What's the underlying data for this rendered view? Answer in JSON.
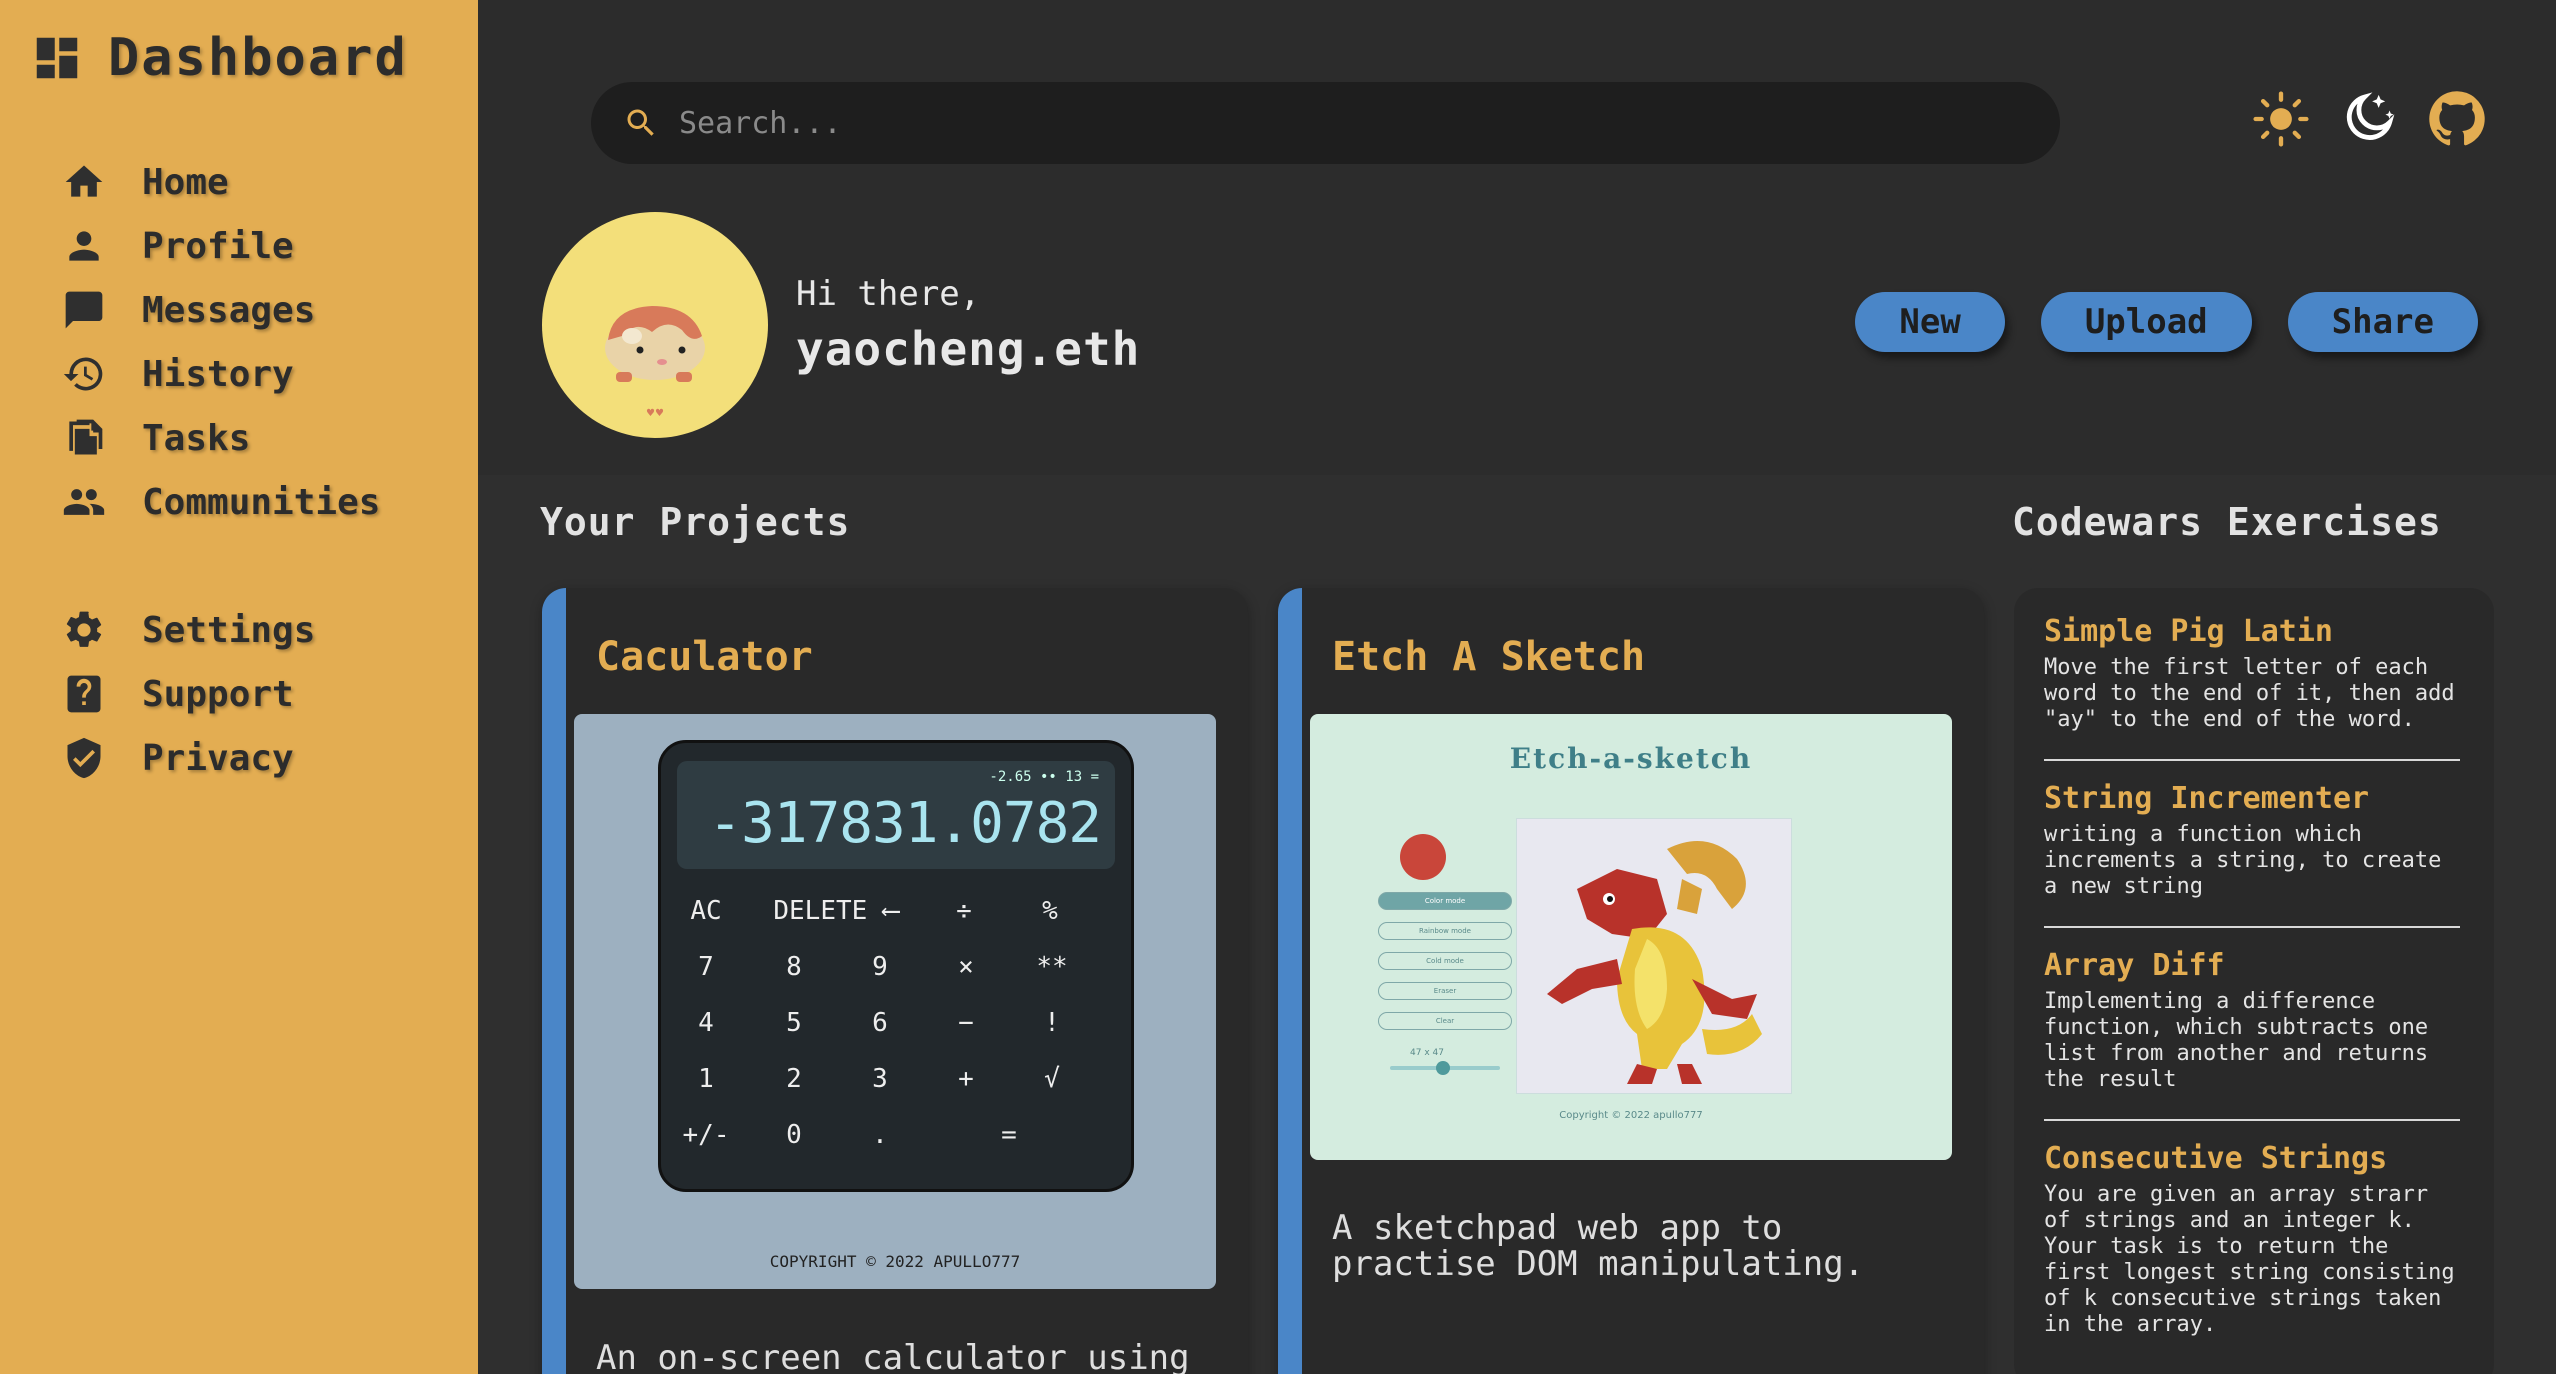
{
  "sidebar": {
    "brand": "Dashboard",
    "items": [
      {
        "label": "Home",
        "icon": "home-icon"
      },
      {
        "label": "Profile",
        "icon": "person-icon"
      },
      {
        "label": "Messages",
        "icon": "message-icon"
      },
      {
        "label": "History",
        "icon": "history-icon"
      },
      {
        "label": "Tasks",
        "icon": "tasks-icon"
      },
      {
        "label": "Communities",
        "icon": "people-icon"
      }
    ],
    "secondary_items": [
      {
        "label": "Settings",
        "icon": "gear-icon"
      },
      {
        "label": "Support",
        "icon": "help-icon"
      },
      {
        "label": "Privacy",
        "icon": "shield-icon"
      }
    ]
  },
  "header": {
    "search_placeholder": "Search...",
    "greeting": "Hi there,",
    "username": "yaocheng.eth",
    "actions": [
      "New",
      "Upload",
      "Share"
    ],
    "icons": [
      "sun-icon",
      "moon-stars-icon",
      "github-icon"
    ]
  },
  "projects": {
    "heading": "Your Projects",
    "cards": [
      {
        "title": "Caculator",
        "description": "An on-screen calculator using",
        "preview": {
          "small_readout": "-2.65 •• 13 =",
          "big_readout": "-317831.0782",
          "keys": [
            [
              "AC",
              "DELETE ⟵",
              "÷",
              "%"
            ],
            [
              "7",
              "8",
              "9",
              "×",
              "**"
            ],
            [
              "4",
              "5",
              "6",
              "−",
              "!"
            ],
            [
              "1",
              "2",
              "3",
              "+",
              "√"
            ],
            [
              "+/-",
              "0",
              ".",
              "="
            ]
          ],
          "copyright": "COPYRIGHT © 2022 APULLO777"
        }
      },
      {
        "title": "Etch A Sketch",
        "description": "A sketchpad web app to practise DOM manipulating.",
        "preview": {
          "title": "Etch-a-sketch",
          "options": [
            "Color mode",
            "Rainbow mode",
            "Cold mode",
            "Eraser",
            "Clear"
          ],
          "size": "47 x 47",
          "copyright": "Copyright © 2022 apullo777"
        }
      }
    ]
  },
  "codewars": {
    "heading": "Codewars Exercises",
    "items": [
      {
        "title": "Simple Pig Latin",
        "desc": "Move the first letter of each word to the end of it, then add \"ay\" to the end of the word."
      },
      {
        "title": "String Incrementer",
        "desc": "writing a function which increments a string, to create a new string"
      },
      {
        "title": "Array Diff",
        "desc": "Implementing a difference function, which subtracts one list from another and returns the result"
      },
      {
        "title": "Consecutive Strings",
        "desc": "You are given an array strarr of strings and an integer k. Your task is to return the first longest string consisting of k consecutive strings taken in the array."
      }
    ]
  },
  "colors": {
    "sidebar": "#e3ad52",
    "accent_blue": "#4a86c8",
    "background": "#2f2f2f"
  }
}
